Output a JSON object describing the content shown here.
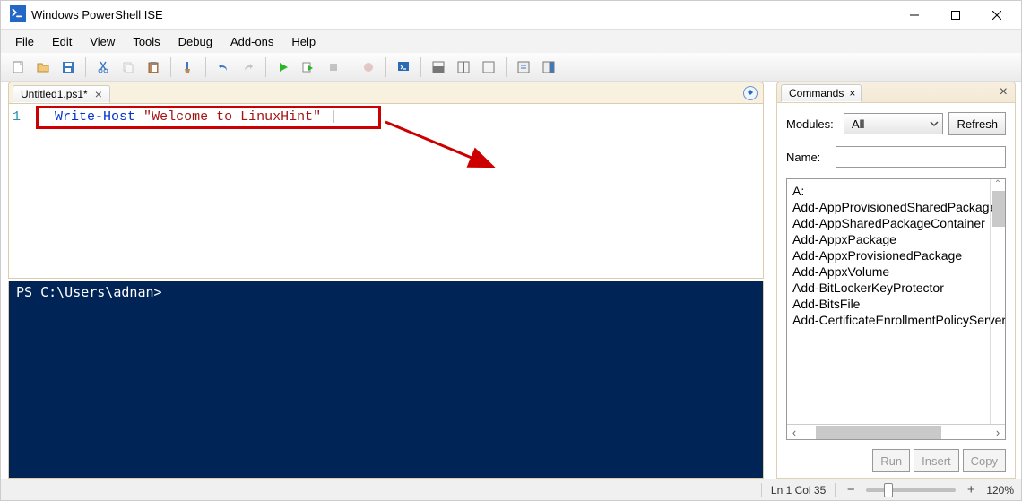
{
  "window": {
    "title": "Windows PowerShell ISE"
  },
  "menu": {
    "file": "File",
    "edit": "Edit",
    "view": "View",
    "tools": "Tools",
    "debug": "Debug",
    "addons": "Add-ons",
    "help": "Help"
  },
  "editor_tab": {
    "label": "Untitled1.ps1*"
  },
  "code": {
    "lineno": "1",
    "cmd": "Write-Host",
    "str_open": "\"",
    "str_text": "Welcome to LinuxHint",
    "str_close": "\"",
    "cursor": "|"
  },
  "console": {
    "prompt": "PS C:\\Users\\adnan>"
  },
  "commands": {
    "tab_label": "Commands",
    "modules_label": "Modules:",
    "modules_value": "All",
    "refresh": "Refresh",
    "name_label": "Name:",
    "name_value": "",
    "items": [
      "A:",
      "Add-AppProvisionedSharedPackageContainer",
      "Add-AppSharedPackageContainer",
      "Add-AppxPackage",
      "Add-AppxProvisionedPackage",
      "Add-AppxVolume",
      "Add-BitLockerKeyProtector",
      "Add-BitsFile",
      "Add-CertificateEnrollmentPolicyServer"
    ],
    "run": "Run",
    "insert": "Insert",
    "copy": "Copy"
  },
  "status": {
    "pos": "Ln 1  Col 35",
    "zoom": "120%"
  }
}
